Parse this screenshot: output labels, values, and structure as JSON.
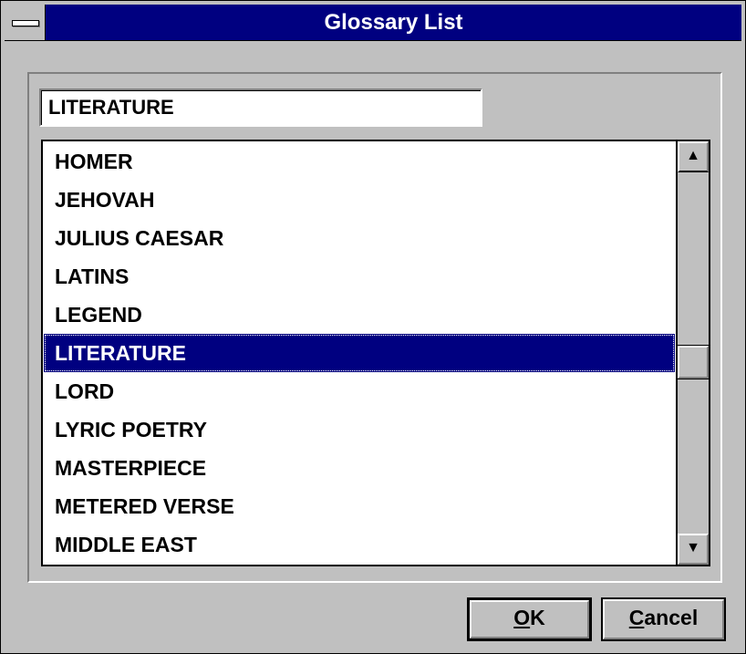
{
  "window": {
    "title": "Glossary List"
  },
  "search": {
    "value": "LITERATURE"
  },
  "list": {
    "items": [
      "HOMER",
      "JEHOVAH",
      "JULIUS CAESAR",
      "LATINS",
      "LEGEND",
      "LITERATURE",
      "LORD",
      "LYRIC POETRY",
      "MASTERPIECE",
      "METERED VERSE",
      "MIDDLE EAST"
    ],
    "selected": "LITERATURE"
  },
  "scrollbar": {
    "up_icon": "arrow-up-icon",
    "down_icon": "arrow-down-icon",
    "position": 0.5
  },
  "buttons": {
    "ok_mnemonic": "O",
    "ok_rest": "K",
    "cancel_mnemonic": "C",
    "cancel_rest": "ancel"
  },
  "colors": {
    "titlebar": "#000080",
    "selection": "#000080",
    "face": "#c0c0c0"
  }
}
